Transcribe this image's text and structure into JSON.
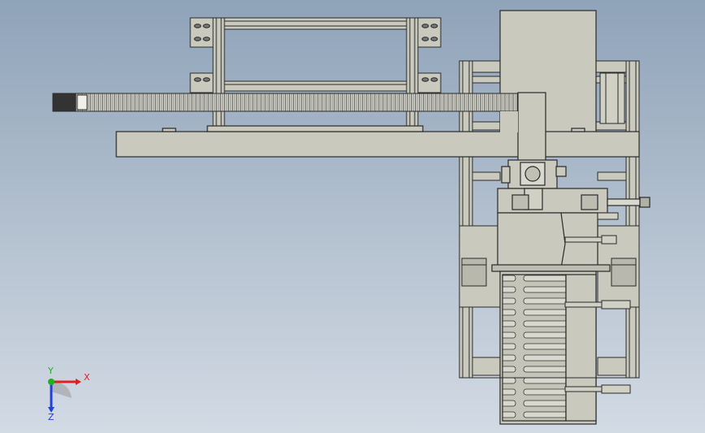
{
  "viewport": {
    "background_top": "#8fa3b9",
    "background_bottom": "#d2dae4",
    "part_fill": "#c9c9bd",
    "part_fill_dark": "#a8a89c",
    "edge_color": "#2a2a2a"
  },
  "triad": {
    "x_label": "X",
    "y_label": "Y",
    "z_label": "Z",
    "x_color": "#e02020",
    "y_color": "#20b020",
    "z_color": "#2040e0"
  }
}
